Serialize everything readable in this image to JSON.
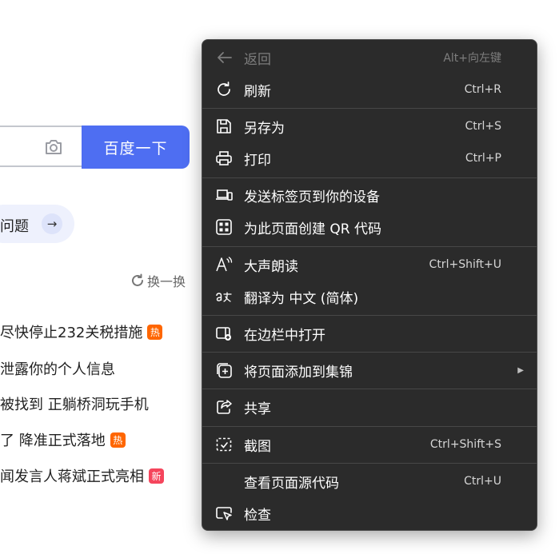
{
  "background_page": {
    "search_button_label": "百度一下",
    "ai_pill_text": "问题",
    "ai_pill_arrow": "→",
    "refresh_label": "换一换",
    "hot_list": [
      {
        "text": "尽快停止232关税措施",
        "badge": "热"
      },
      {
        "text": "泄露你的个人信息",
        "badge": ""
      },
      {
        "text": "被找到 正躺桥洞玩手机",
        "badge": ""
      },
      {
        "text": "了 降准正式落地",
        "badge": "热"
      },
      {
        "text": "闻发言人蒋斌正式亮相",
        "badge": "新"
      }
    ]
  },
  "context_menu": {
    "items": [
      {
        "id": "back",
        "label": "返回",
        "shortcut": "Alt+向左键",
        "icon": "back-arrow-icon",
        "disabled": true
      },
      {
        "id": "refresh",
        "label": "刷新",
        "shortcut": "Ctrl+R",
        "icon": "refresh-icon"
      },
      {
        "id": "save-as",
        "label": "另存为",
        "shortcut": "Ctrl+S",
        "icon": "save-icon"
      },
      {
        "id": "print",
        "label": "打印",
        "shortcut": "Ctrl+P",
        "icon": "printer-icon"
      },
      {
        "id": "send-tab",
        "label": "发送标签页到你的设备",
        "shortcut": "",
        "icon": "devices-icon"
      },
      {
        "id": "qr-code",
        "label": "为此页面创建 QR 代码",
        "shortcut": "",
        "icon": "qr-code-icon"
      },
      {
        "id": "read-aloud",
        "label": "大声朗读",
        "shortcut": "Ctrl+Shift+U",
        "icon": "read-aloud-icon"
      },
      {
        "id": "translate",
        "label": "翻译为 中文 (简体)",
        "shortcut": "",
        "icon": "translate-icon"
      },
      {
        "id": "sidebar",
        "label": "在边栏中打开",
        "shortcut": "",
        "icon": "sidebar-open-icon"
      },
      {
        "id": "collections",
        "label": "将页面添加到集锦",
        "shortcut": "",
        "icon": "collections-icon",
        "submenu": true
      },
      {
        "id": "share",
        "label": "共享",
        "shortcut": "",
        "icon": "share-icon"
      },
      {
        "id": "screenshot",
        "label": "截图",
        "shortcut": "Ctrl+Shift+S",
        "icon": "screenshot-icon"
      },
      {
        "id": "view-source",
        "label": "查看页面源代码",
        "shortcut": "Ctrl+U",
        "icon": ""
      },
      {
        "id": "inspect",
        "label": "检查",
        "shortcut": "",
        "icon": "inspect-icon"
      }
    ]
  },
  "colors": {
    "menu_bg": "#2b2b2b",
    "menu_separator": "#474747",
    "baidu_blue": "#4e6ef2",
    "hot_badge": "#ff6600",
    "new_badge": "#f5455c"
  }
}
